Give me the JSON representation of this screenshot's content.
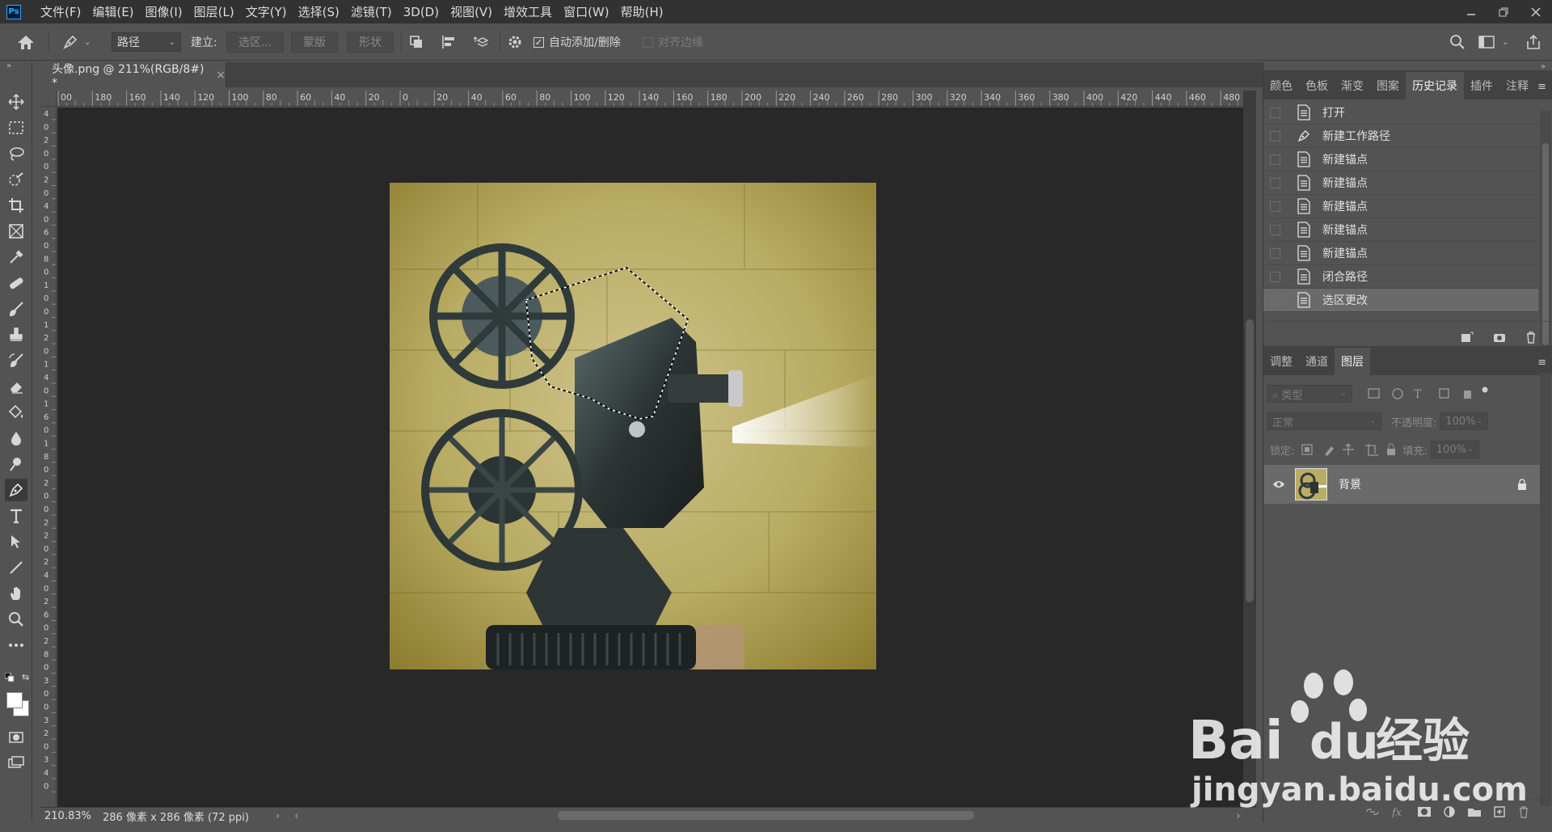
{
  "app": {
    "logo": "Ps"
  },
  "menu": [
    "文件(F)",
    "编辑(E)",
    "图像(I)",
    "图层(L)",
    "文字(Y)",
    "选择(S)",
    "滤镜(T)",
    "3D(D)",
    "视图(V)",
    "增效工具",
    "窗口(W)",
    "帮助(H)"
  ],
  "options": {
    "mode": "路径",
    "build_label": "建立:",
    "selection_btn": "选区...",
    "mask_btn": "蒙版",
    "shape_btn": "形状",
    "auto_add_label": "自动添加/删除",
    "auto_add_checked": true,
    "align_edges_label": "对齐边缘",
    "align_edges_checked": false
  },
  "document": {
    "tab_title": "头像.png @ 211%(RGB/8#) *",
    "close": "×",
    "zoom": "210.83%",
    "info": "286 像素 x 286 像素 (72 ppi)",
    "ruler_h": [
      "00",
      "180",
      "160",
      "140",
      "120",
      "100",
      "80",
      "60",
      "40",
      "20",
      "0",
      "20",
      "40",
      "60",
      "80",
      "100",
      "120",
      "140",
      "160",
      "180",
      "200",
      "220",
      "240",
      "260",
      "280",
      "300",
      "320",
      "340",
      "360",
      "380",
      "400",
      "420",
      "440",
      "460",
      "480"
    ],
    "ruler_v": [
      "4",
      "0",
      "2",
      "0",
      "0",
      "2",
      "0",
      "4",
      "0",
      "6",
      "0",
      "8",
      "0",
      "1",
      "0",
      "0",
      "1",
      "2",
      "0",
      "1",
      "4",
      "0",
      "1",
      "6",
      "0",
      "1",
      "8",
      "0",
      "2",
      "0",
      "0",
      "2",
      "2",
      "0",
      "2",
      "4",
      "0",
      "2",
      "6",
      "0",
      "2",
      "8",
      "0",
      "3",
      "0",
      "0",
      "3",
      "2",
      "0",
      "3",
      "4",
      "0"
    ]
  },
  "history_panel": {
    "tabs": [
      "颜色",
      "色板",
      "渐变",
      "图案",
      "历史记录",
      "插件",
      "注释"
    ],
    "active_tab": "历史记录",
    "items": [
      {
        "label": "打开",
        "icon": "document-icon"
      },
      {
        "label": "新建工作路径",
        "icon": "pen-icon"
      },
      {
        "label": "新建锚点",
        "icon": "document-icon"
      },
      {
        "label": "新建锚点",
        "icon": "document-icon"
      },
      {
        "label": "新建锚点",
        "icon": "document-icon"
      },
      {
        "label": "新建锚点",
        "icon": "document-icon"
      },
      {
        "label": "新建锚点",
        "icon": "document-icon"
      },
      {
        "label": "闭合路径",
        "icon": "document-icon"
      },
      {
        "label": "选区更改",
        "icon": "document-icon"
      }
    ],
    "selected_index": 8
  },
  "layers_panel": {
    "tabs": [
      "调整",
      "通道",
      "图层"
    ],
    "active_tab": "图层",
    "filter_label": "类型",
    "blend_mode": "正常",
    "opacity_label": "不透明度:",
    "opacity_value": "100%",
    "lock_label": "锁定:",
    "fill_label": "填充:",
    "fill_value": "100%",
    "layers": [
      {
        "name": "背景",
        "visible": true,
        "locked": true
      }
    ]
  },
  "watermark": {
    "brand": "Bai",
    "brand2": "du",
    "cn": "经验",
    "url": "jingyan.baidu.com"
  },
  "colors": {
    "accent": "#31a8ff",
    "chrome_dark": "#323232",
    "panel": "#535353",
    "canvas_bg": "#282828"
  }
}
